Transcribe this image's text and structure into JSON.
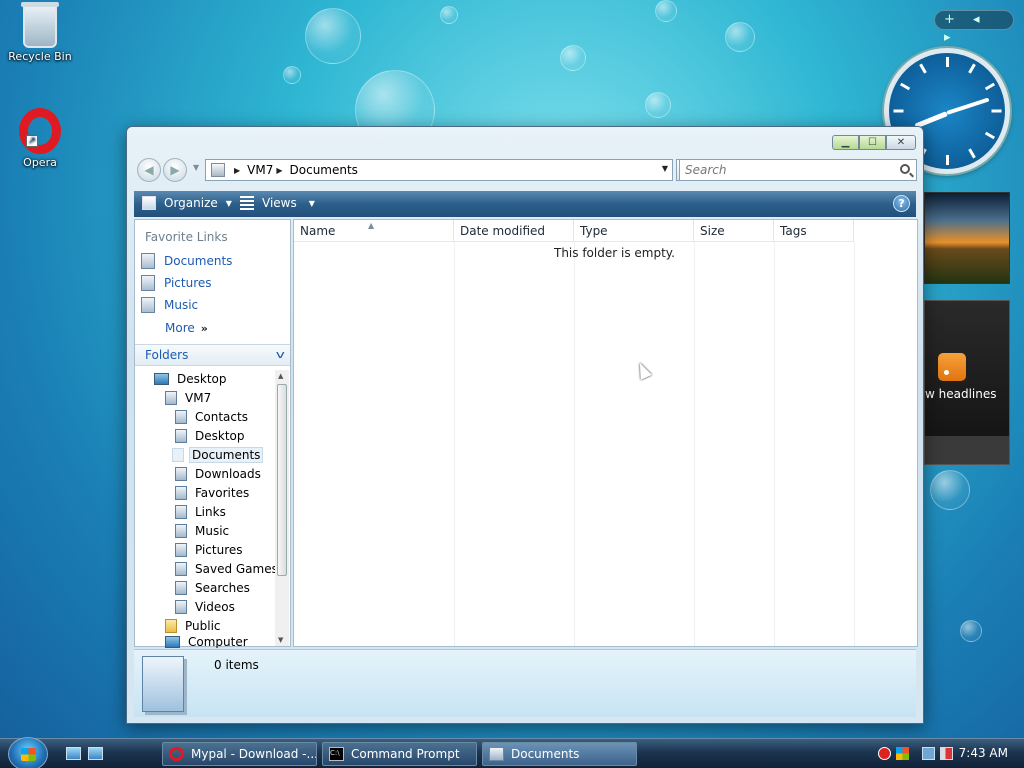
{
  "desktop": {
    "icons": [
      {
        "label": "Recycle Bin"
      },
      {
        "label": "Opera"
      }
    ],
    "gadgets": {
      "feed_text": "w headlines",
      "sidebar_controls": [
        "+",
        "◂",
        "▸"
      ]
    }
  },
  "explorer": {
    "title_buttons": [
      "▁",
      "☐",
      "✕"
    ],
    "breadcrumb": [
      "VM7",
      "Documents"
    ],
    "search_placeholder": "Search",
    "toolbar": {
      "organize": "Organize",
      "views": "Views",
      "help": "?"
    },
    "favorite_links": {
      "header": "Favorite Links",
      "items": [
        "Documents",
        "Pictures",
        "Music"
      ],
      "more": "More"
    },
    "folders": {
      "header": "Folders",
      "tree": [
        {
          "label": "Desktop",
          "level": 0
        },
        {
          "label": "VM7",
          "level": 1
        },
        {
          "label": "Contacts",
          "level": 2
        },
        {
          "label": "Desktop",
          "level": 2
        },
        {
          "label": "Documents",
          "level": 2,
          "selected": true
        },
        {
          "label": "Downloads",
          "level": 2
        },
        {
          "label": "Favorites",
          "level": 2
        },
        {
          "label": "Links",
          "level": 2
        },
        {
          "label": "Music",
          "level": 2
        },
        {
          "label": "Pictures",
          "level": 2
        },
        {
          "label": "Saved Games",
          "level": 2
        },
        {
          "label": "Searches",
          "level": 2
        },
        {
          "label": "Videos",
          "level": 2
        },
        {
          "label": "Public",
          "level": 1
        },
        {
          "label": "Computer",
          "level": 1
        }
      ]
    },
    "columns": [
      "Name",
      "Date modified",
      "Type",
      "Size",
      "Tags"
    ],
    "empty_message": "This folder is empty.",
    "details": {
      "item_count": "0 items"
    }
  },
  "taskbar": {
    "tasks": [
      {
        "label": "Mypal - Download -...",
        "icon": "opera-icon"
      },
      {
        "label": "Command Prompt",
        "icon": "cmd-icon"
      },
      {
        "label": "Documents",
        "icon": "folder-icon",
        "active": true
      }
    ],
    "time": "7:43 AM"
  }
}
